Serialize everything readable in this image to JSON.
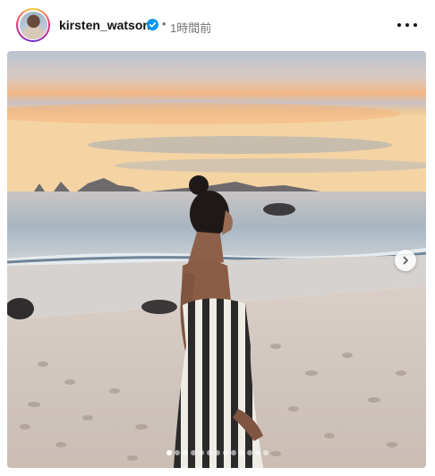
{
  "post": {
    "username": "kirsten_watson",
    "verified": true,
    "separator": "•",
    "timestamp": "1時間前"
  },
  "icons": {
    "more": "more-horizontal-icon",
    "verified": "verified-badge-icon",
    "next": "chevron-right-icon"
  },
  "carousel": {
    "total_slides": 13,
    "current_slide": 1
  },
  "colors": {
    "verified_blue": "#0095f6",
    "text_secondary": "#737373"
  }
}
